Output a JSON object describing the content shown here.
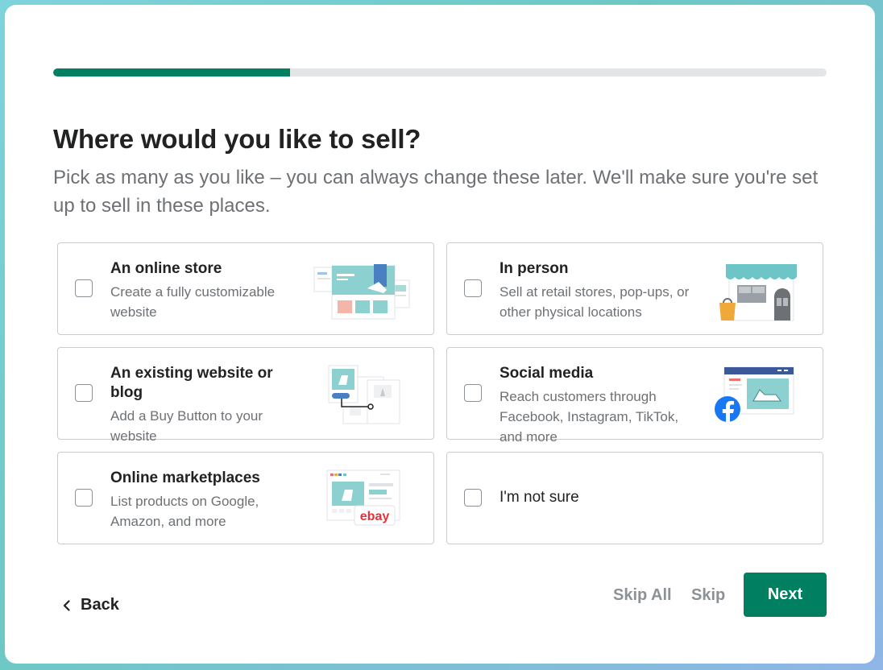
{
  "progress": {
    "fraction": 0.306
  },
  "header": {
    "title": "Where would you like to sell?",
    "subtitle": "Pick as many as you like – you can always change these later. We'll make sure you're set up to sell in these places."
  },
  "options": [
    {
      "title": "An online store",
      "description": "Create a fully customizable website",
      "icon": "online-store-illustration",
      "checked": false
    },
    {
      "title": "In person",
      "description": "Sell at retail stores, pop-ups, or other physical locations",
      "icon": "storefront-illustration",
      "checked": false
    },
    {
      "title": "An existing website or blog",
      "description": "Add a Buy Button to your website",
      "icon": "buy-button-illustration",
      "checked": false
    },
    {
      "title": "Social media",
      "description": "Reach customers through Facebook, Instagram, TikTok, and more",
      "icon": "social-media-illustration",
      "checked": false
    },
    {
      "title": "Online marketplaces",
      "description": "List products on Google, Amazon, and more",
      "icon": "marketplace-illustration",
      "checked": false
    },
    {
      "title": "I'm not sure",
      "checked": false
    }
  ],
  "illustration_text": {
    "ebay": "ebay"
  },
  "footer": {
    "back_label": "Back",
    "skip_all_label": "Skip All",
    "skip_label": "Skip",
    "next_label": "Next"
  },
  "colors": {
    "accent": "#008060",
    "progress_track": "#e4e5e7",
    "facebook": "#1877f2"
  }
}
